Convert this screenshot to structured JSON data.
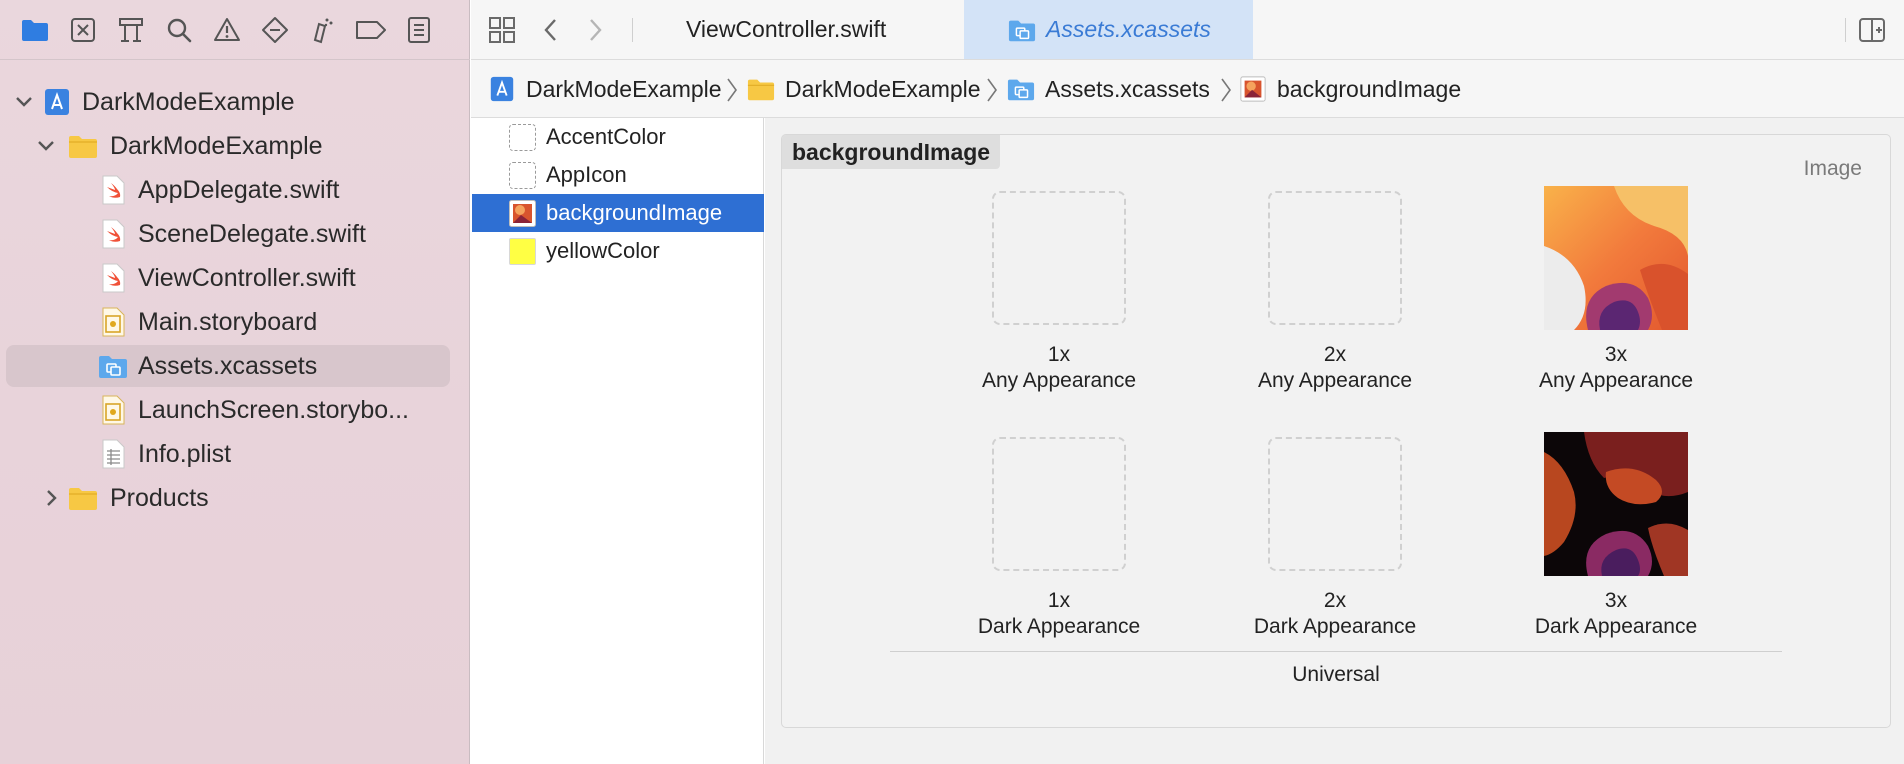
{
  "navigator": {
    "toolbar_icons": [
      "folder-icon",
      "source-control-icon",
      "symbol-icon",
      "search-icon",
      "warning-icon",
      "test-icon",
      "debug-icon",
      "breakpoint-icon",
      "report-icon"
    ],
    "tree": [
      {
        "label": "DarkModeExample",
        "kind": "project",
        "expanded": true
      },
      {
        "label": "DarkModeExample",
        "kind": "folder",
        "expanded": true
      },
      {
        "label": "AppDelegate.swift",
        "kind": "swift"
      },
      {
        "label": "SceneDelegate.swift",
        "kind": "swift"
      },
      {
        "label": "ViewController.swift",
        "kind": "swift"
      },
      {
        "label": "Main.storyboard",
        "kind": "storyboard"
      },
      {
        "label": "Assets.xcassets",
        "kind": "assets",
        "selected": true
      },
      {
        "label": "LaunchScreen.storybo...",
        "kind": "storyboard"
      },
      {
        "label": "Info.plist",
        "kind": "plist"
      },
      {
        "label": "Products",
        "kind": "folder",
        "expanded": false
      }
    ]
  },
  "editor": {
    "tabs": [
      {
        "label": "ViewController.swift",
        "active": false
      },
      {
        "label": "Assets.xcassets",
        "active": true
      }
    ],
    "breadcrumbs": [
      "DarkModeExample",
      "DarkModeExample",
      "Assets.xcassets",
      "backgroundImage"
    ]
  },
  "asset_list": [
    {
      "label": "AccentColor",
      "kind": "color-set"
    },
    {
      "label": "AppIcon",
      "kind": "icon-set"
    },
    {
      "label": "backgroundImage",
      "kind": "image-set",
      "selected": true
    },
    {
      "label": "yellowColor",
      "kind": "color",
      "color": "#ffff44"
    }
  ],
  "asset_detail": {
    "name": "backgroundImage",
    "type": "Image",
    "rows": [
      {
        "appearance": "Any Appearance",
        "slots": [
          {
            "scale": "1x",
            "filled": false
          },
          {
            "scale": "2x",
            "filled": false
          },
          {
            "scale": "3x",
            "filled": true,
            "variant": "light"
          }
        ]
      },
      {
        "appearance": "Dark Appearance",
        "slots": [
          {
            "scale": "1x",
            "filled": false
          },
          {
            "scale": "2x",
            "filled": false
          },
          {
            "scale": "3x",
            "filled": true,
            "variant": "dark"
          }
        ]
      }
    ],
    "group_label": "Universal"
  },
  "colors": {
    "accent": "#2e6fd3",
    "sidebar_bg": "#e8d4db",
    "active_tab_bg": "#d3e3f7",
    "active_tab_text": "#3a7bd5",
    "yellow_swatch": "#ffff44"
  }
}
